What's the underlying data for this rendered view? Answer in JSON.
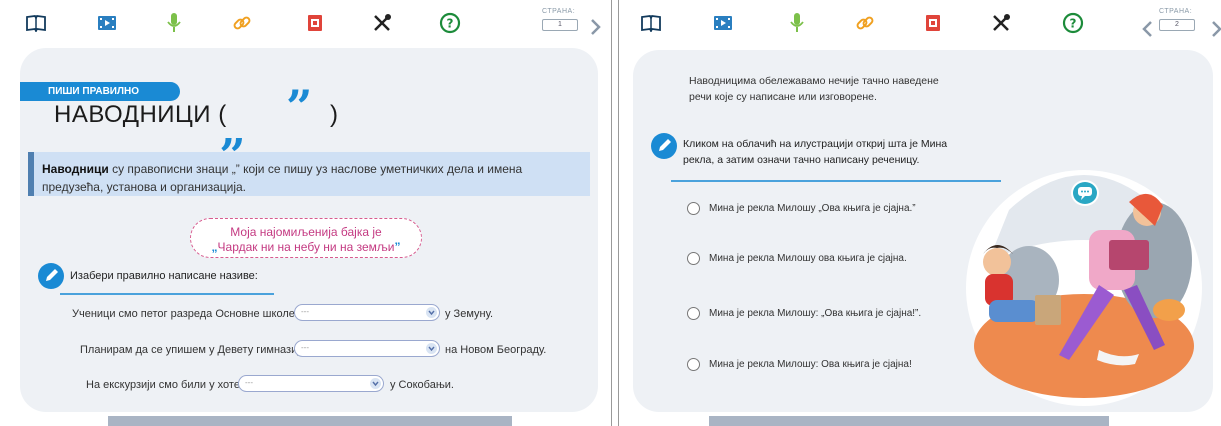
{
  "left": {
    "pager": {
      "label": "СТРАНА:",
      "value": "1"
    },
    "badge": "ПИШИ ПРАВИЛНО",
    "title": "НАВОДНИЦИ (",
    "title_close": ")",
    "open_quote": "„",
    "close_quote": "”",
    "info": {
      "bold": "Наводници",
      "text": " су правописни знаци „” који се пишу уз наслове уметничких дела и имена предузећа, установа и организација."
    },
    "cloud": {
      "line1": "Моја најомиљенија бајка је",
      "line2": "Чардак ни на небу ни на земљи"
    },
    "task": "Изабери правилно написане називе:",
    "sentences": [
      {
        "before": "Ученици смо петог разреда Основне школе",
        "placeholder": "---",
        "after": "у Земуну."
      },
      {
        "before": "Планирам да се упишем у Девету гимназију",
        "placeholder": "---",
        "after": "на Новом Београду."
      },
      {
        "before": "На екскурзији смо били у хотелу",
        "placeholder": "---",
        "after": "у Сокобањи."
      }
    ]
  },
  "right": {
    "pager": {
      "label": "СТРАНА:",
      "value": "2"
    },
    "intro": [
      "Наводницима обележавамо нечије тачно наведене",
      "речи које су написане или изговорене."
    ],
    "task": [
      "Кликом на облачић на илустрацији откриј шта је Мина",
      "рекла, а затим означи тачно написану реченицу."
    ],
    "options": [
      "Мина је рекла Милошу „Ова књига је сјајна.”",
      "Мина је рекла Милошу ова књига је сјајна.",
      "Мина је рекла Милошу: „Ова књига је сјајна!”.",
      "Мина је рекла Милошу: Ова књига је сјајна!"
    ]
  },
  "colors": {
    "accent": "#1a8ad4",
    "card": "#eef1f5",
    "info": "#cfe0f4",
    "cloud": "#c43a82"
  },
  "icons": [
    "book-icon",
    "video-icon",
    "microphone-icon",
    "link-icon",
    "worksheet-icon",
    "tools-icon",
    "help-icon",
    "chevron-right-icon",
    "chevron-left-icon",
    "pencil-icon",
    "chat-bubble-icon"
  ]
}
